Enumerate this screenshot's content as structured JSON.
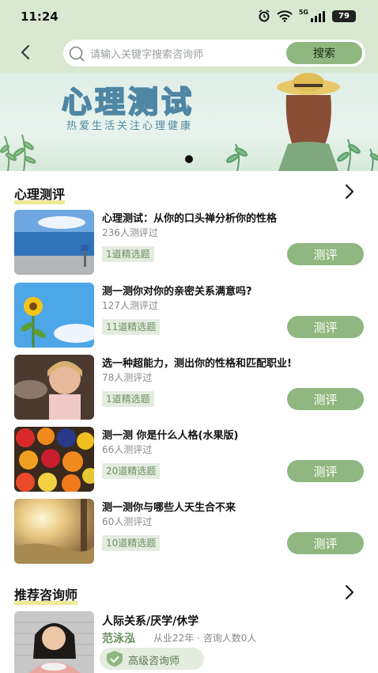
{
  "status_bar": {
    "time": "11:24",
    "battery": "79",
    "network": "5G"
  },
  "search": {
    "placeholder": "请输入关键字搜索咨询师",
    "button": "搜索"
  },
  "banner": {
    "title": "心理测试",
    "subtitle": "热爱生活关注心理健康"
  },
  "tests_section": {
    "title": "心理测评",
    "items": [
      {
        "title": "心理测试：从你的口头禅分析你的性格",
        "count": "236人测评过",
        "tag": "1道精选题",
        "button": "测评"
      },
      {
        "title": "测一测你对你的亲密关系满意吗?",
        "count": "127人测评过",
        "tag": "11道精选题",
        "button": "测评"
      },
      {
        "title": "选一种超能力，测出你的性格和匹配职业!",
        "count": "78人测评过",
        "tag": "1道精选题",
        "button": "测评"
      },
      {
        "title": "测一测 你是什么人格(水果版)",
        "count": "66人测评过",
        "tag": "20道精选题",
        "button": "测评"
      },
      {
        "title": "测一测你与哪些人天生合不来",
        "count": "60人测评过",
        "tag": "10道精选题",
        "button": "测评"
      }
    ]
  },
  "counselors_section": {
    "title": "推荐咨询师",
    "items": [
      {
        "specialty": "人际关系/厌学/休学",
        "name": "范泳泓",
        "info": "从业22年 · 咨询人数0人",
        "badge": "高级咨询师"
      }
    ]
  },
  "colors": {
    "accent": "#8fb77f",
    "header_bg": "#d9e8d0",
    "tag_bg": "#e4ece0"
  }
}
